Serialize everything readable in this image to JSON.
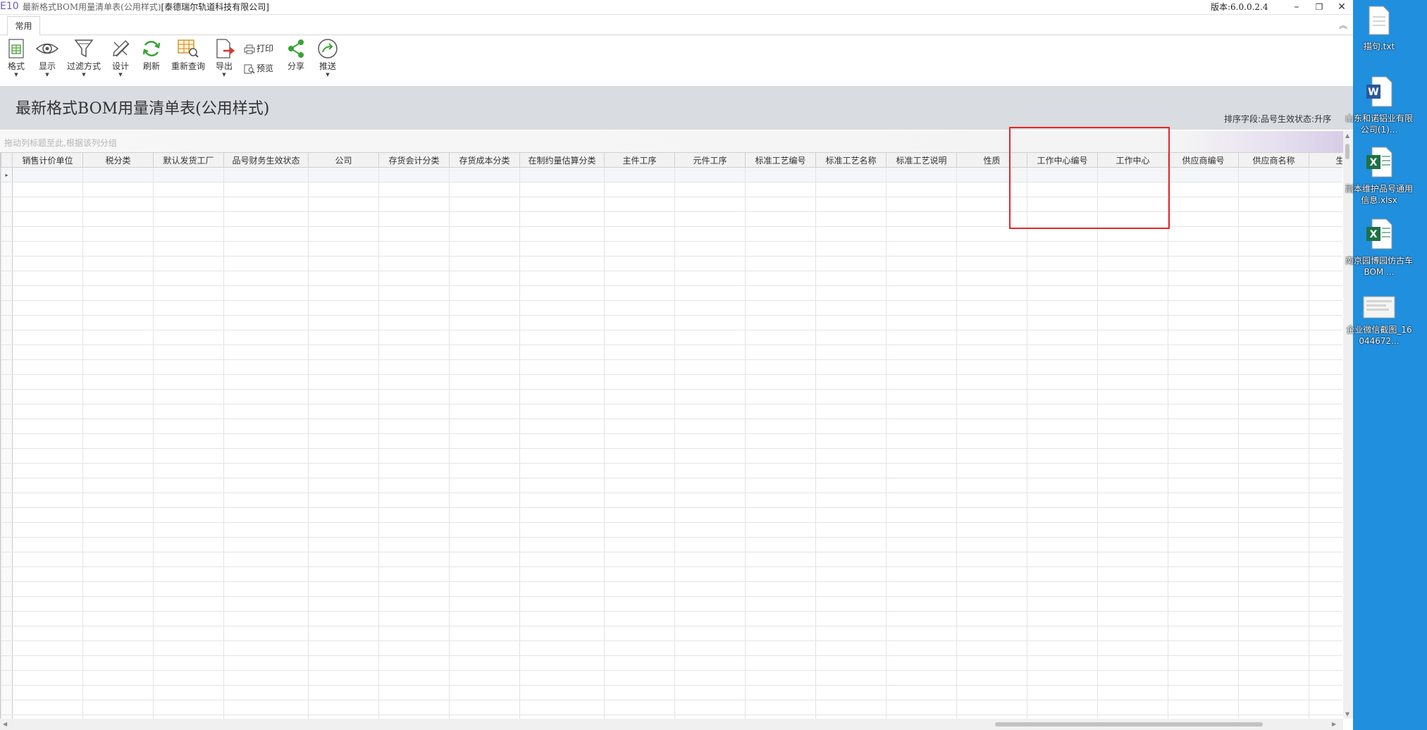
{
  "titlebar": {
    "logo": "E10",
    "title": "最新格式BOM用量清单表(公用样式)",
    "company": "[泰德瑞尔轨道科技有限公司]",
    "version": "版本:6.0.0.2.4",
    "minimize": "–",
    "restore": "❐",
    "close": "✕"
  },
  "ribbon": {
    "tab": "常用",
    "collapse": "︽",
    "buttons": {
      "format": "格式",
      "display": "显示",
      "filter": "过滤方式",
      "design": "设计",
      "refresh": "刷新",
      "requery": "重新查询",
      "export": "导出",
      "print": "打印",
      "preview": "预览",
      "share": "分享",
      "push": "推送"
    }
  },
  "report": {
    "title": "最新格式BOM用量清单表(公用样式)",
    "sort_info": "排序字段:品号生效状态:升序",
    "group_hint": "拖动列标题至此,根据该列分组"
  },
  "grid": {
    "columns": [
      "销售计价单位",
      "税分类",
      "默认发货工厂",
      "品号财务生效状态",
      "公司",
      "存货会计分类",
      "存货成本分类",
      "在制约量估算分类",
      "主件工序",
      "元件工序",
      "标准工艺编号",
      "标准工艺名称",
      "标准工艺说明",
      "性质",
      "工作中心编号",
      "工作中心",
      "供应商编号",
      "供应商名称",
      "生产"
    ],
    "row_indicator": "▸"
  },
  "desktop": {
    "icons": [
      {
        "label": "描句.txt",
        "icon": "text-file-icon"
      },
      {
        "label": "山东和诺铝业有限公司(1)...",
        "icon": "word-file-icon"
      },
      {
        "label": "副本维护品号通用信息.xlsx",
        "icon": "excel-file-icon"
      },
      {
        "label": "南京园博园仿古车 BOM ...",
        "icon": "excel-file-icon"
      },
      {
        "label": "企业微信截图_16044672...",
        "icon": "image-file-icon"
      }
    ]
  },
  "colors": {
    "highlight": "#e8252a",
    "desktop": "#1f8fde",
    "excel": "#1e7145",
    "word": "#2b579a"
  }
}
